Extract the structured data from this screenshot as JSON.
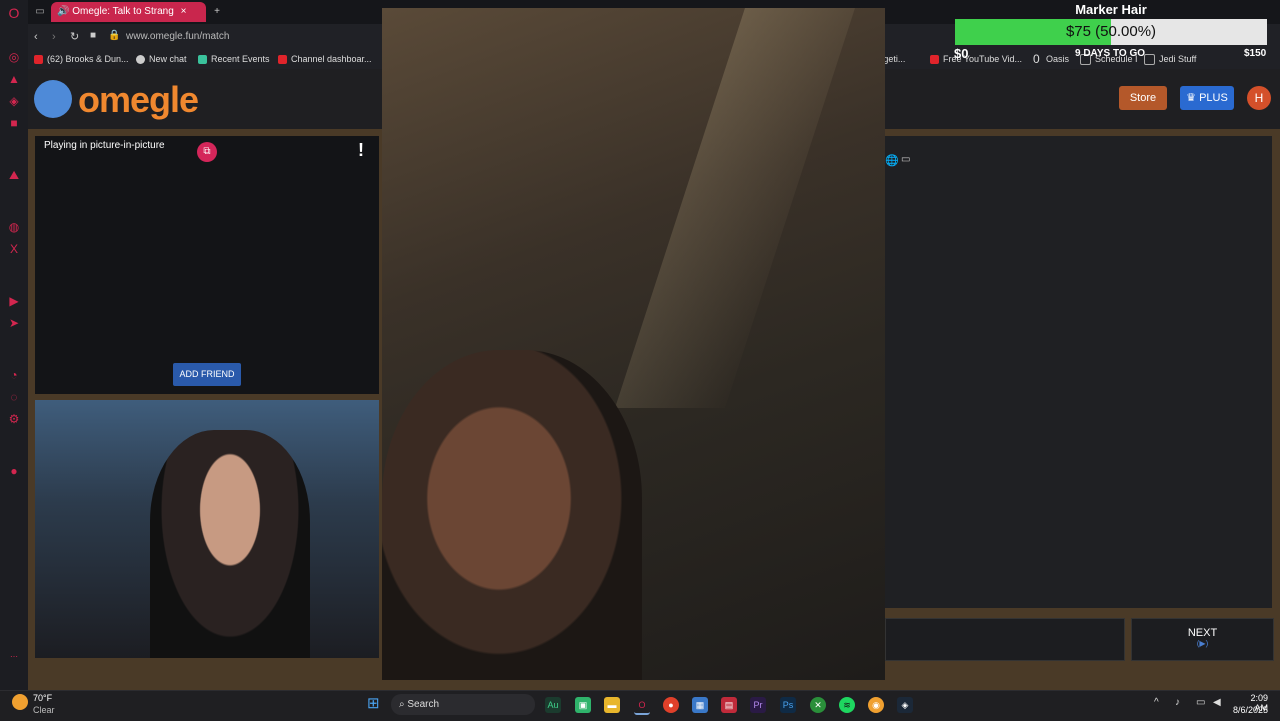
{
  "browser": {
    "tab_title": "Omegle: Talk to Strang",
    "url": "www.omegle.fun/match",
    "bookmarks": [
      "(62) Brooks & Dun...",
      "New chat",
      "Recent Events",
      "Channel dashboar...",
      "r | geti...",
      "Free YouTube Vid...",
      "Oasis",
      "Schedule I",
      "Jedi Stuff"
    ],
    "bookmark_count": "0"
  },
  "site": {
    "logo": "omegle",
    "store": "Store",
    "plus": "PLUS",
    "avatar_initial": "H"
  },
  "stranger": {
    "pip_label": "Playing in picture-in-picture",
    "report": "!",
    "add_friend": "ADD FRIEND"
  },
  "controls": {
    "next": "NEXT",
    "next_sub": "(▶)"
  },
  "goal": {
    "title": "Marker Hair",
    "amount": "$75 (50.00%)",
    "progress": 0.5,
    "start": "$0",
    "days_left": "9 DAYS TO GO",
    "end": "$150",
    "fill_color": "#3fd04c"
  },
  "taskbar": {
    "weather_temp": "70°F",
    "weather_desc": "Clear",
    "search": "Search",
    "time": "2:09 AM",
    "date": "8/6/2025"
  }
}
